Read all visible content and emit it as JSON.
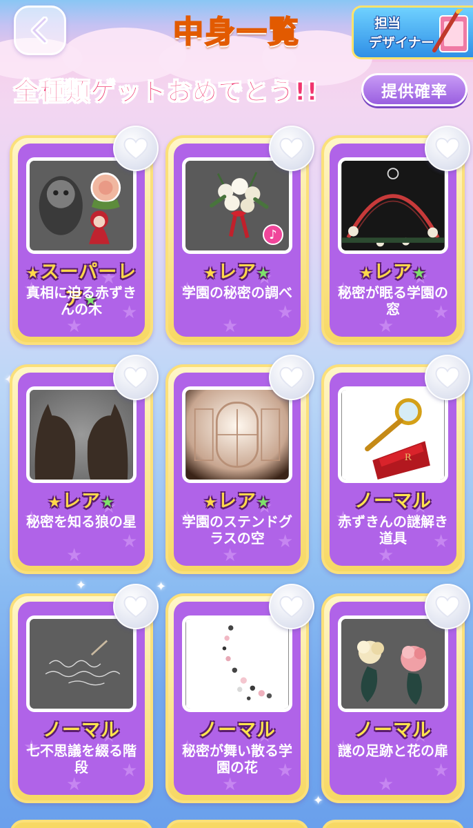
{
  "header": {
    "title": "中身一覧",
    "designer_line1": "担当",
    "designer_line2": "デザイナー"
  },
  "banner": {
    "complete_text": "全種類ゲットおめでとう!!",
    "rate_button": "提供確率"
  },
  "items": [
    {
      "rarity": "スーパーレア",
      "name": "真相に迫る赤ずきんの木",
      "thumb": "wolf-and-red-riding-hood",
      "music": false
    },
    {
      "rarity": "レア",
      "name": "学園の秘密の調べ",
      "thumb": "white-rose-bouquet",
      "music": true
    },
    {
      "rarity": "レア",
      "name": "秘密が眠る学園の窓",
      "thumb": "gothic-window-frame",
      "music": false
    },
    {
      "rarity": "レア",
      "name": "秘密を知る狼の星",
      "thumb": "wolf-silhouettes",
      "music": false
    },
    {
      "rarity": "レア",
      "name": "学園のステンドグラスの空",
      "thumb": "stained-glass-hall",
      "music": false
    },
    {
      "rarity": "ノーマル",
      "name": "赤ずきんの謎解き道具",
      "thumb": "magnifier-and-red-book",
      "music": false
    },
    {
      "rarity": "ノーマル",
      "name": "七不思議を綴る階段",
      "thumb": "handwritten-script",
      "music": false
    },
    {
      "rarity": "ノーマル",
      "name": "秘密が舞い散る学園の花",
      "thumb": "falling-petals",
      "music": false
    },
    {
      "rarity": "ノーマル",
      "name": "謎の足跡と花の扉",
      "thumb": "pink-and-cream-flowers",
      "music": false
    }
  ],
  "colors": {
    "card_inner": "#b063e8",
    "title_orange": "#ffb21f",
    "complete_pink": "#f0346e",
    "rarity_yellow": "#ffd84a"
  },
  "icons": {
    "back": "chevron-left-icon",
    "favorite": "heart-icon",
    "music": "music-note-icon"
  }
}
